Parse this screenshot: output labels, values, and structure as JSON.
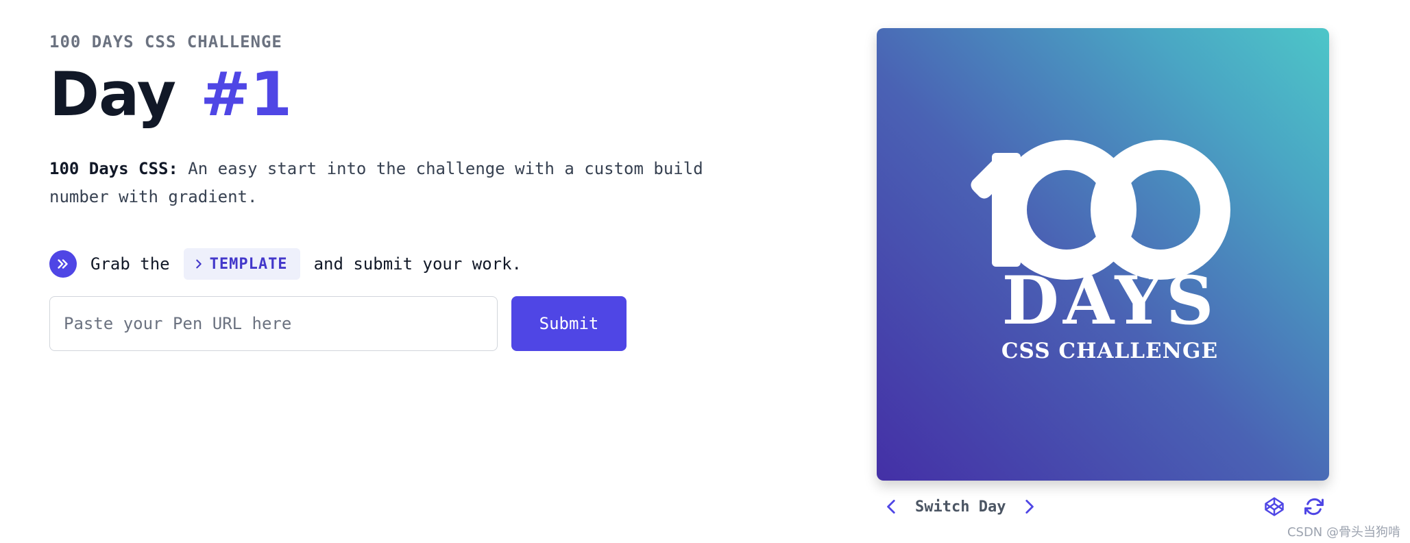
{
  "header": {
    "eyebrow": "100 DAYS CSS CHALLENGE",
    "title_prefix": "Day",
    "title_number": "#1"
  },
  "description": {
    "bold": "100 Days CSS:",
    "text": " An easy start into the challenge with a custom build number with gradient."
  },
  "grab": {
    "before": "Grab the",
    "template_label": "TEMPLATE",
    "after": "and submit your work."
  },
  "form": {
    "url_placeholder": "Paste your Pen URL here",
    "url_value": "",
    "submit_label": "Submit"
  },
  "preview": {
    "logo_number": "100",
    "logo_days": "DAYS",
    "logo_subtitle": "CSS CHALLENGE"
  },
  "switcher": {
    "label": "Switch Day"
  },
  "icons": {
    "grab": "double-chevron-right-icon",
    "template": "chevron-right-icon",
    "prev": "chevron-left-icon",
    "next": "chevron-right-icon",
    "codepen": "codepen-icon",
    "reload": "refresh-icon"
  },
  "colors": {
    "accent": "#4f46e5",
    "gradient_start": "#4430a6",
    "gradient_end": "#4dc6c8"
  },
  "watermark": "CSDN @骨头当狗啃"
}
